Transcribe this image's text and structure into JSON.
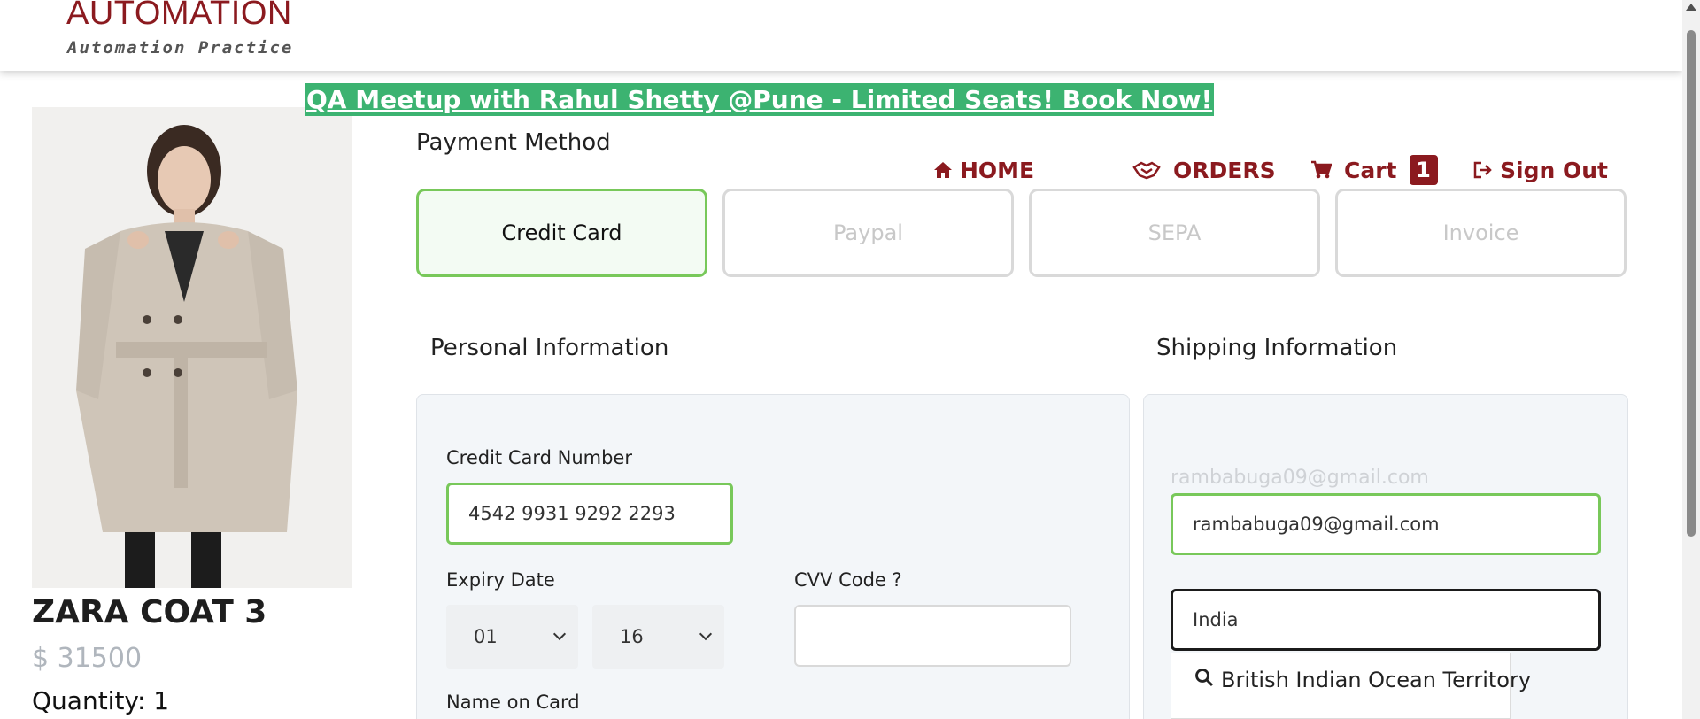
{
  "header": {
    "logo_title": "AUTOMATION",
    "logo_subtitle": "Automation Practice"
  },
  "banner": {
    "text": "QA Meetup with Rahul Shetty @Pune - Limited Seats! Book Now!"
  },
  "nav": {
    "home": "HOME",
    "orders": "ORDERS",
    "cart": "Cart",
    "cart_count": "1",
    "sign_out": "Sign Out"
  },
  "product": {
    "name": "ZARA COAT 3",
    "price": "$ 31500",
    "quantity": "Quantity: 1"
  },
  "payment": {
    "title": "Payment Method",
    "methods": [
      "Credit Card",
      "Paypal",
      "SEPA",
      "Invoice"
    ],
    "selected": "Credit Card"
  },
  "personal": {
    "title": "Personal Information",
    "card_number_label": "Credit Card Number",
    "card_number_value": "4542 9931 9292 2293",
    "expiry_label": "Expiry Date",
    "expiry_month": "01",
    "expiry_year": "16",
    "cvv_label": "CVV Code ?",
    "cvv_value": "",
    "name_label": "Name on Card"
  },
  "shipping": {
    "title": "Shipping Information",
    "email_display": "rambabuga09@gmail.com",
    "email_value": "rambabuga09@gmail.com",
    "country_value": "India",
    "suggestion": "British Indian Ocean Territory"
  },
  "colors": {
    "brand": "#8b1a1f",
    "banner_green": "#3cb371",
    "active_border": "#78c85a"
  }
}
